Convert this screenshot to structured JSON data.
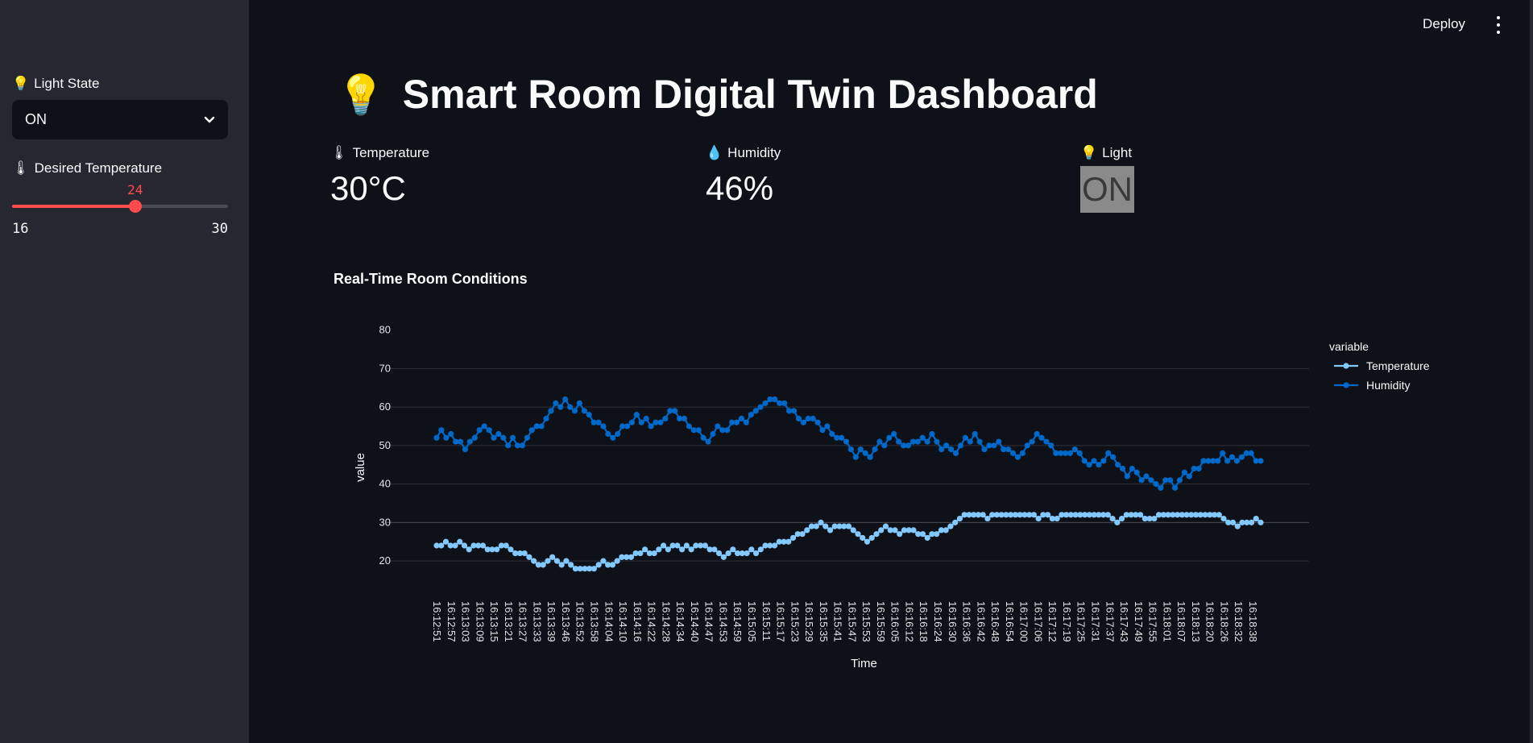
{
  "sidebar": {
    "light_state": {
      "emoji": "💡",
      "label": "Light State",
      "selected": "ON"
    },
    "desired_temp": {
      "emoji": "🌡",
      "label": "Desired Temperature",
      "value": 24,
      "min": 16,
      "max": 30
    }
  },
  "header": {
    "deploy": "Deploy"
  },
  "main": {
    "title_emoji": "💡",
    "title": "Smart Room Digital Twin Dashboard",
    "metrics": [
      {
        "emoji": "🌡",
        "label": "Temperature",
        "value": "30°C"
      },
      {
        "emoji": "💧",
        "label": "Humidity",
        "value": "46%"
      },
      {
        "emoji": "💡",
        "label": "Light",
        "value": "ON"
      }
    ],
    "chart_heading": "Real-Time Room Conditions"
  },
  "colors": {
    "temperature": "#83c9ff",
    "humidity": "#0068c9",
    "accent": "#ff4b4b"
  },
  "chart_data": {
    "type": "line",
    "xlabel": "Time",
    "ylabel": "value",
    "ylim": [
      15,
      82
    ],
    "yticks": [
      20,
      30,
      40,
      50,
      60,
      70,
      80
    ],
    "legend_title": "variable",
    "legend_position": "top-right",
    "x_start": "16:12:51",
    "x_step_seconds": 3,
    "x_tick_labels": [
      "16:12:51",
      "16:12:57",
      "16:13:03",
      "16:13:09",
      "16:13:15",
      "16:13:21",
      "16:13:27",
      "16:13:33",
      "16:13:39",
      "16:13:46",
      "16:13:52",
      "16:13:58",
      "16:14:04",
      "16:14:10",
      "16:14:16",
      "16:14:22",
      "16:14:28",
      "16:14:34",
      "16:14:40",
      "16:14:47",
      "16:14:53",
      "16:14:59",
      "16:15:05",
      "16:15:11",
      "16:15:17",
      "16:15:23",
      "16:15:29",
      "16:15:35",
      "16:15:41",
      "16:15:47",
      "16:15:53",
      "16:15:59",
      "16:16:05",
      "16:16:12",
      "16:16:18",
      "16:16:24",
      "16:16:30",
      "16:16:36",
      "16:16:42",
      "16:16:48",
      "16:16:54",
      "16:17:00",
      "16:17:06",
      "16:17:12",
      "16:17:19",
      "16:17:25",
      "16:17:31",
      "16:17:37",
      "16:17:43",
      "16:17:49",
      "16:17:55",
      "16:18:01",
      "16:18:07",
      "16:18:13",
      "16:18:20",
      "16:18:26",
      "16:18:32",
      "16:18:38"
    ],
    "series": [
      {
        "name": "Temperature",
        "values": [
          24,
          24,
          25,
          24,
          24,
          25,
          24,
          23,
          24,
          24,
          24,
          23,
          23,
          23,
          24,
          24,
          23,
          22,
          22,
          22,
          21,
          20,
          19,
          19,
          20,
          21,
          20,
          19,
          20,
          19,
          18,
          18,
          18,
          18,
          18,
          19,
          20,
          19,
          19,
          20,
          21,
          21,
          21,
          22,
          22,
          23,
          22,
          22,
          23,
          24,
          23,
          24,
          24,
          23,
          24,
          23,
          24,
          24,
          24,
          23,
          23,
          22,
          21,
          22,
          23,
          22,
          22,
          22,
          23,
          22,
          23,
          24,
          24,
          24,
          25,
          25,
          25,
          26,
          27,
          27,
          28,
          29,
          29,
          30,
          29,
          28,
          29,
          29,
          29,
          29,
          28,
          27,
          26,
          25,
          26,
          27,
          28,
          29,
          28,
          28,
          27,
          28,
          28,
          28,
          27,
          27,
          26,
          27,
          27,
          28,
          28,
          29,
          30,
          31,
          32,
          32,
          32,
          32,
          32,
          31,
          32,
          32,
          32,
          32,
          32,
          32,
          32,
          32,
          32,
          32,
          31,
          32,
          32,
          31,
          31,
          32,
          32,
          32,
          32,
          32,
          32,
          32,
          32,
          32,
          32,
          32,
          31,
          30,
          31,
          32,
          32,
          32,
          32,
          31,
          31,
          31,
          32,
          32,
          32,
          32,
          32,
          32,
          32,
          32,
          32,
          32,
          32,
          32,
          32,
          32,
          31,
          30,
          30,
          29,
          30,
          30,
          30,
          31,
          30
        ]
      },
      {
        "name": "Humidity",
        "values": [
          52,
          54,
          52,
          53,
          51,
          51,
          49,
          51,
          52,
          54,
          55,
          54,
          52,
          53,
          52,
          50,
          52,
          50,
          50,
          52,
          54,
          55,
          55,
          57,
          59,
          61,
          60,
          62,
          60,
          59,
          61,
          59,
          58,
          56,
          56,
          55,
          53,
          52,
          53,
          55,
          55,
          56,
          58,
          56,
          57,
          55,
          56,
          56,
          57,
          59,
          59,
          57,
          57,
          55,
          54,
          54,
          52,
          51,
          53,
          55,
          54,
          54,
          56,
          56,
          57,
          56,
          58,
          59,
          60,
          61,
          62,
          62,
          61,
          61,
          59,
          59,
          57,
          56,
          57,
          57,
          56,
          54,
          55,
          53,
          52,
          52,
          51,
          49,
          47,
          49,
          48,
          47,
          49,
          51,
          50,
          52,
          53,
          51,
          50,
          50,
          51,
          51,
          52,
          51,
          53,
          51,
          49,
          50,
          49,
          48,
          50,
          52,
          51,
          53,
          51,
          49,
          50,
          50,
          51,
          49,
          49,
          48,
          47,
          48,
          50,
          51,
          53,
          52,
          51,
          50,
          48,
          48,
          48,
          48,
          49,
          48,
          46,
          45,
          46,
          45,
          46,
          48,
          47,
          45,
          44,
          42,
          44,
          43,
          41,
          42,
          41,
          40,
          39,
          41,
          41,
          39,
          41,
          43,
          42,
          44,
          44,
          46,
          46,
          46,
          46,
          48,
          46,
          47,
          46,
          47,
          48,
          48,
          46,
          46
        ]
      }
    ]
  }
}
